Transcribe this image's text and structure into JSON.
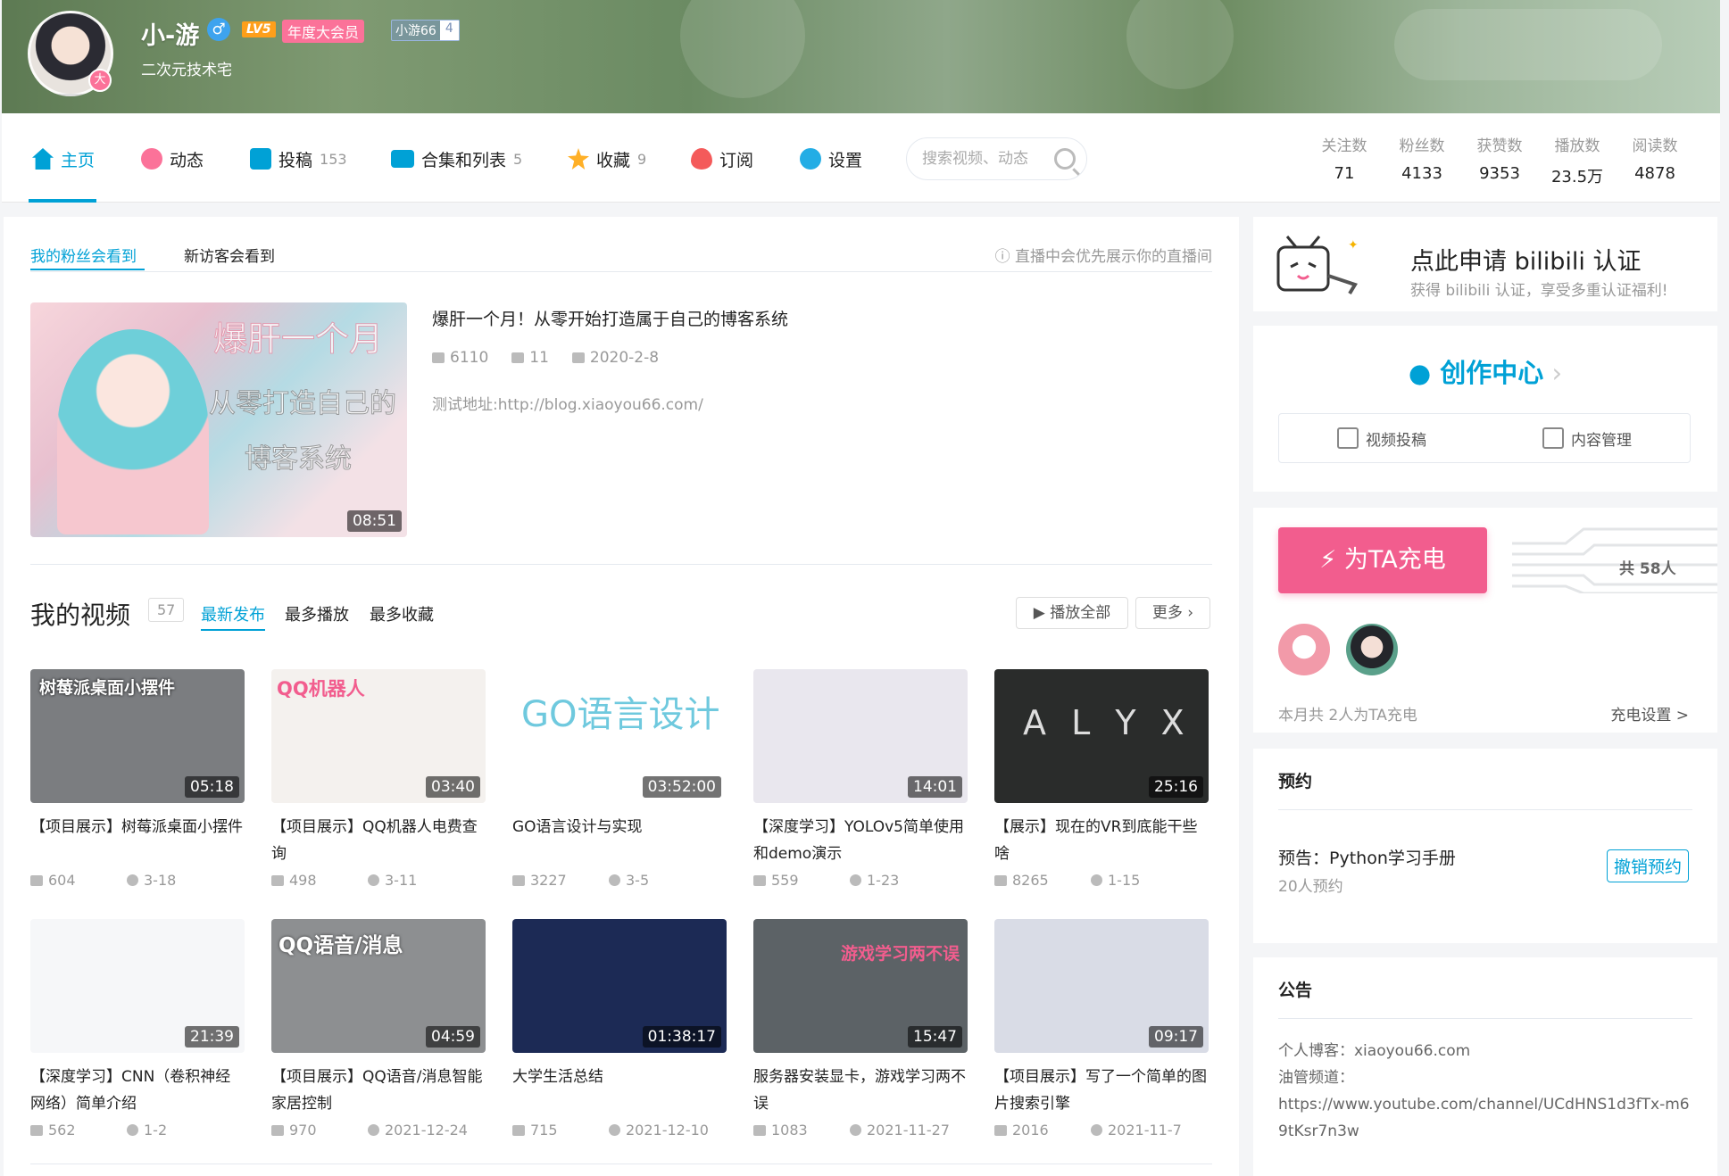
{
  "header": {
    "username": "小-游",
    "sex_icon": "male-icon",
    "level": "LV5",
    "vip_label": "年度大会员",
    "medal_name": "小游66",
    "medal_level": "4",
    "signature": "二次元技术宅",
    "avatar_badge": "大"
  },
  "nav": {
    "items": [
      {
        "label": "主页",
        "count": "",
        "icon": "home-icon"
      },
      {
        "label": "动态",
        "count": "",
        "icon": "dynamic-icon"
      },
      {
        "label": "投稿",
        "count": "153",
        "icon": "upload-icon"
      },
      {
        "label": "合集和列表",
        "count": "5",
        "icon": "collection-icon"
      },
      {
        "label": "收藏",
        "count": "9",
        "icon": "star-icon"
      },
      {
        "label": "订阅",
        "count": "",
        "icon": "heart-icon"
      },
      {
        "label": "设置",
        "count": "",
        "icon": "gear-icon"
      }
    ],
    "search_placeholder": "搜索视频、动态"
  },
  "stats": [
    {
      "label": "关注数",
      "value": "71"
    },
    {
      "label": "粉丝数",
      "value": "4133"
    },
    {
      "label": "获赞数",
      "value": "9353"
    },
    {
      "label": "播放数",
      "value": "23.5万"
    },
    {
      "label": "阅读数",
      "value": "4878"
    }
  ],
  "featured": {
    "tab_fans": "我的粉丝会看到",
    "tab_visitors": "新访客会看到",
    "tip": "直播中会优先展示你的直播间",
    "thumb_text_1": "爆肝一个月",
    "thumb_text_2": "从零打造自己的",
    "thumb_text_3": "博客系统",
    "duration": "08:51",
    "title": "爆肝一个月！从零开始打造属于自己的博客系统",
    "plays": "6110",
    "danmaku": "11",
    "date": "2020-2-8",
    "desc": "测试地址:http://blog.xiaoyou66.com/"
  },
  "videos_section": {
    "title": "我的视频",
    "count": "57",
    "tabs": [
      "最新发布",
      "最多播放",
      "最多收藏"
    ],
    "play_all": "播放全部",
    "more": "更多"
  },
  "videos": [
    {
      "title": "【项目展示】树莓派桌面小摆件",
      "duration": "05:18",
      "plays": "604",
      "date": "3-18",
      "thumb_text": "树莓派桌面小摆件",
      "bg": "#7b7d80"
    },
    {
      "title": "【项目展示】QQ机器人电费查询",
      "duration": "03:40",
      "plays": "498",
      "date": "3-11",
      "thumb_text": "QQ机器人",
      "bg": "#f4f1ee"
    },
    {
      "title": "GO语言设计与实现",
      "duration": "03:52:00",
      "plays": "3227",
      "date": "3-5",
      "thumb_text": "GO语言设计",
      "bg": "#ffffff"
    },
    {
      "title": "【深度学习】YOLOv5简单使用和demo演示",
      "duration": "14:01",
      "plays": "559",
      "date": "1-23",
      "thumb_text": "",
      "bg": "#e9e7ee"
    },
    {
      "title": "【展示】现在的VR到底能干些啥",
      "duration": "25:16",
      "plays": "8265",
      "date": "1-15",
      "thumb_text": "A L Y X",
      "bg": "#2a2c2b"
    },
    {
      "title": "【深度学习】CNN（卷积神经网络）简单介绍",
      "duration": "21:39",
      "plays": "562",
      "date": "1-2",
      "thumb_text": "",
      "bg": "#f6f7f9"
    },
    {
      "title": "【项目展示】QQ语音/消息智能家居控制",
      "duration": "04:59",
      "plays": "970",
      "date": "2021-12-24",
      "thumb_text": "QQ语音/消息",
      "bg": "#8d8f91"
    },
    {
      "title": "大学生活总结",
      "duration": "01:38:17",
      "plays": "715",
      "date": "2021-12-10",
      "thumb_text": "",
      "bg": "#1c2a55"
    },
    {
      "title": "服务器安装显卡，游戏学习两不误",
      "duration": "15:47",
      "plays": "1083",
      "date": "2021-11-27",
      "thumb_text": "游戏学习两不误",
      "bg": "#5c6266"
    },
    {
      "title": "【项目展示】写了一个简单的图片搜索引擎",
      "duration": "09:17",
      "plays": "2016",
      "date": "2021-11-7",
      "thumb_text": "",
      "bg": "#d9dce6"
    }
  ],
  "auth": {
    "title": "点此申请 bilibili 认证",
    "subtitle": "获得 bilibili 认证，享受多重认证福利!"
  },
  "creator": {
    "title": "创作中心",
    "upload": "视频投稿",
    "manage": "内容管理"
  },
  "charge": {
    "button": "为TA充电",
    "total": "共 58人",
    "footer": "本月共 2人为TA充电",
    "settings": "充电设置 >"
  },
  "reservation": {
    "head": "预约",
    "title": "预告：Python学习手册",
    "count": "20人预约",
    "cancel": "撤销预约"
  },
  "announcement": {
    "head": "公告",
    "line1": "个人博客：xiaoyou66.com",
    "line2": "油管频道：",
    "line3": "https://www.youtube.com/channel/UCdHNS1d3fTx-m69tKsr7n3w"
  },
  "colors": {
    "accent": "#00a1d6",
    "pink": "#f25d8e",
    "vip": "#fb7299"
  }
}
